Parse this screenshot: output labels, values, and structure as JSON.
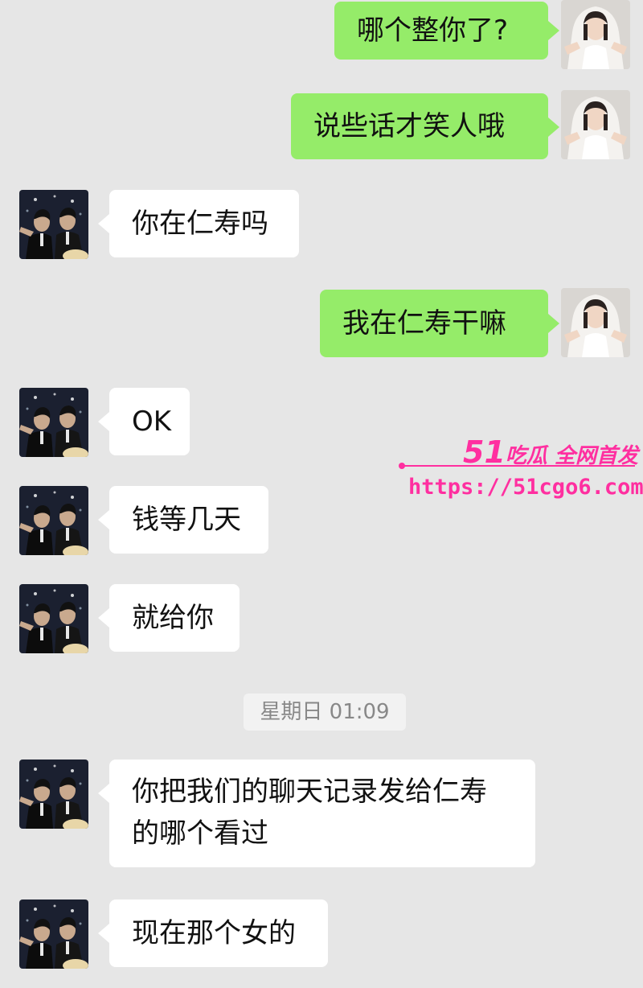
{
  "messages": [
    {
      "sender": "me",
      "text": "哪个整你了?"
    },
    {
      "sender": "me",
      "text": "说些话才笑人哦"
    },
    {
      "sender": "them",
      "text": "你在仁寿吗"
    },
    {
      "sender": "me",
      "text": "我在仁寿干嘛"
    },
    {
      "sender": "them",
      "text": "OK"
    },
    {
      "sender": "them",
      "text": "钱等几天"
    },
    {
      "sender": "them",
      "text": "就给你"
    },
    {
      "sender": "them",
      "text_line1": "你把我们的聊天记录发给仁寿",
      "text_line2": "的哪个看过"
    },
    {
      "sender": "them",
      "text": "现在那个女的"
    }
  ],
  "timestamp": "星期日 01:09",
  "watermark": {
    "brand_num": "51",
    "brand_text": "吃瓜 全网首发",
    "url": "https://51cgo6.com"
  },
  "colors": {
    "background": "#e6e6e6",
    "bubble_me": "#95ec69",
    "bubble_them": "#ffffff",
    "watermark": "#ff2fa0"
  },
  "icons": {
    "me_avatar": "bride-photo-avatar",
    "them_avatar": "night-photo-avatar"
  }
}
